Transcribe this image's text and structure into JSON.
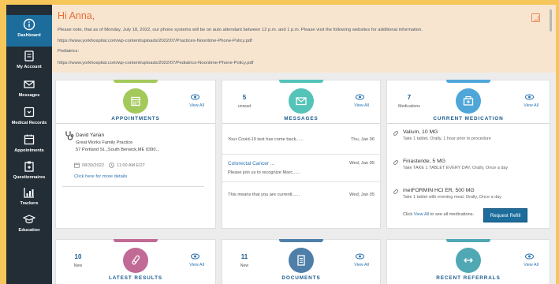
{
  "sidebar": {
    "items": [
      {
        "label": "Dashboard",
        "icon": "info-icon"
      },
      {
        "label": "My Account",
        "icon": "document-icon"
      },
      {
        "label": "Messages",
        "icon": "envelope-icon"
      },
      {
        "label": "Medical Records",
        "icon": "folder-icon"
      },
      {
        "label": "Appointments",
        "icon": "calendar-icon"
      },
      {
        "label": "Questionnaires",
        "icon": "clipboard-icon"
      },
      {
        "label": "Trackers",
        "icon": "chart-icon"
      },
      {
        "label": "Education",
        "icon": "graduation-cap-icon"
      }
    ]
  },
  "notice": {
    "greeting": "Hi Anna,",
    "line1": "Please note, that as of Monday, July 18, 2022, our phone systems will be on auto attendant between 12 p.m. and 1 p.m. Please visit the following websites for additional information.",
    "line2": "https://www.yorkhospital.com/wp-content/uploads/2022/07/Practices-Noontime-Phone-Policy.pdf",
    "line3": "Pediatrics:",
    "line4": "https://www.yorkhospital.com/wp-content/uploads/2022/07/Pediatrics-Noontime-Phone-Policy.pdf"
  },
  "cards": {
    "appointments": {
      "title": "APPOINTMENTS",
      "view_all": "View All",
      "doctor": "David Yarian",
      "practice": "Great Works Family Practice",
      "address": "57 Portland St.,,South Berwick,ME 0390...",
      "date": "08/30/2022",
      "time": "11:00 AM EDT",
      "link": "Click here for more details"
    },
    "messages": {
      "count": "5",
      "count_label": "unread",
      "title": "MESSAGES",
      "view_all": "View All",
      "items": [
        {
          "subject": "",
          "preview": "Your Covid-19 test has come back......",
          "date": "Thu, Jan 06"
        },
        {
          "subject": "Colorectal Cancer ...",
          "preview": "Please join us to recognize Marc......",
          "date": "Wed, Jan 05"
        },
        {
          "subject": "",
          "preview": "This means that you are currentl......",
          "date": "Wed, Jan 05"
        }
      ]
    },
    "medication": {
      "count": "7",
      "count_label": "Medications",
      "title": "CURRENT MEDICATION",
      "view_all": "View All",
      "items": [
        {
          "name": "Valium, 10 MG",
          "desc": "Take 1 tablet, Orally, 1 hour prior to procedure"
        },
        {
          "name": "Finasteride, 5 MG",
          "desc": "Take TAKE 1 TABLET EVERY DAY, Orally, Once a day"
        },
        {
          "name": "metFORMIN HCl ER, 500 MG",
          "desc": "Take 1 tablet with evening meal, Orally, Once a day"
        }
      ],
      "footer_prefix": "Click",
      "footer_link": "View All",
      "footer_suffix": "to see all medications.",
      "refill_button": "Request Refill"
    },
    "results": {
      "count": "10",
      "count_label": "New",
      "title": "LATEST RESULTS",
      "view_all": "View All"
    },
    "documents": {
      "count": "11",
      "count_label": "New",
      "title": "DOCUMENTS",
      "view_all": "View All"
    },
    "referrals": {
      "title": "RECENT REFERRALS",
      "view_all": "View All"
    }
  },
  "colors": {
    "appointments": "#a4c95b",
    "messages": "#54c3b8",
    "medication": "#4fa6d8",
    "results": "#c06a95",
    "documents": "#4f7fa9",
    "referrals": "#4fa8b4"
  }
}
